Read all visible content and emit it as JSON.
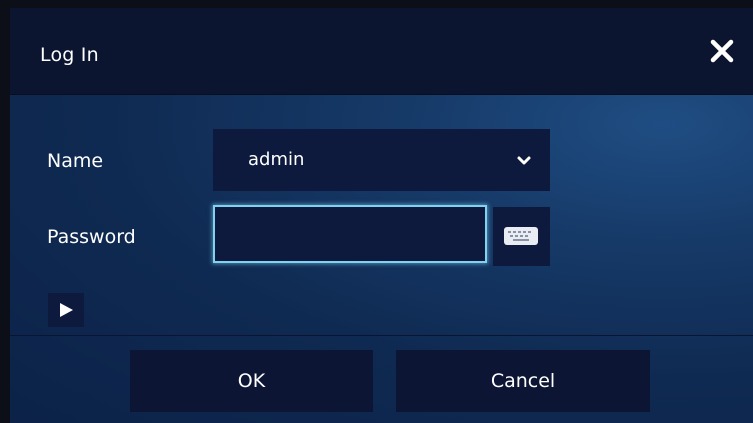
{
  "dialog": {
    "title": "Log In",
    "close_icon": "close-icon"
  },
  "form": {
    "name_label": "Name",
    "name_value": "admin",
    "name_dropdown_icon": "chevron-down-icon",
    "password_label": "Password",
    "password_value": "",
    "keyboard_icon": "keyboard-icon",
    "expand_icon": "play-triangle-icon"
  },
  "buttons": {
    "ok_label": "OK",
    "cancel_label": "Cancel"
  },
  "colors": {
    "dialog_background": "#163a68",
    "titlebar": "#0b1530",
    "field_background": "#0d1a3d",
    "focus_border": "#7fd3f0",
    "text": "#ffffff"
  }
}
